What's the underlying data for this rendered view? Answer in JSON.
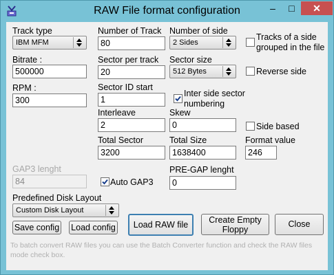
{
  "window": {
    "title": "RAW File format configuration",
    "controls": {
      "minimize": "–",
      "maximize": "□",
      "close": "✕"
    }
  },
  "track_type": {
    "label": "Track type",
    "value": "IBM MFM"
  },
  "bitrate": {
    "label": "Bitrate :",
    "value": "500000"
  },
  "rpm": {
    "label": "RPM :",
    "value": "300"
  },
  "number_of_track": {
    "label": "Number of Track",
    "value": "80"
  },
  "sector_per_track": {
    "label": "Sector per track",
    "value": "20"
  },
  "sector_id_start": {
    "label": "Sector ID start",
    "value": "1"
  },
  "interleave": {
    "label": "Interleave",
    "value": "2"
  },
  "total_sector": {
    "label": "Total Sector",
    "value": "3200"
  },
  "number_of_side": {
    "label": "Number of side",
    "value": "2 Sides"
  },
  "sector_size": {
    "label": "Sector size",
    "value": "512 Bytes"
  },
  "skew": {
    "label": "Skew",
    "value": "0"
  },
  "total_size": {
    "label": "Total Size",
    "value": "1638400"
  },
  "format_value": {
    "label": "Format value",
    "value": "246"
  },
  "tracks_grouped": {
    "label_line1": "Tracks of a side",
    "label_line2": "grouped in the file",
    "checked": false
  },
  "reverse_side": {
    "label": "Reverse side",
    "checked": false
  },
  "inter_side_numbering": {
    "label_line1": "Inter side sector",
    "label_line2": "numbering",
    "checked": true
  },
  "side_based": {
    "label": "Side based",
    "checked": false
  },
  "gap3": {
    "label": "GAP3 lenght",
    "value": "84"
  },
  "auto_gap3": {
    "label": "Auto GAP3",
    "checked": true
  },
  "pre_gap": {
    "label": "PRE-GAP lenght",
    "value": "0"
  },
  "predefined_layout": {
    "label": "Predefined Disk Layout",
    "value": "Custom Disk Layout"
  },
  "buttons": {
    "save_config": "Save config",
    "load_config": "Load config",
    "load_raw_file": "Load RAW file",
    "create_empty_line1": "Create Empty",
    "create_empty_line2": "Floppy",
    "close": "Close"
  },
  "footer": {
    "line1": "To batch convert RAW files you can use the Batch Converter function and check the RAW files",
    "line2": "mode check box."
  }
}
